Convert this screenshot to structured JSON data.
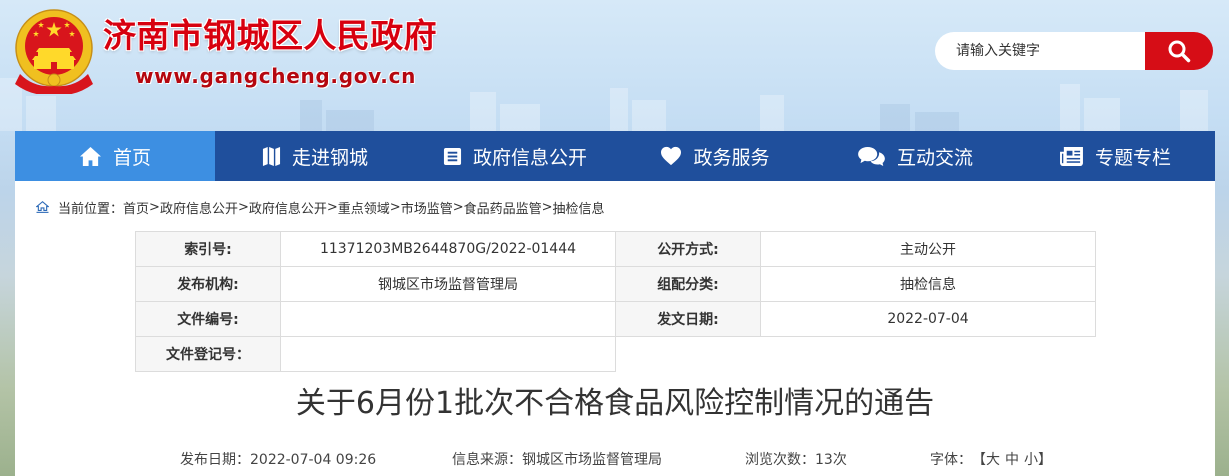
{
  "site": {
    "title": "济南市钢城区人民政府",
    "url": "www.gangcheng.gov.cn",
    "emblem_icon": "national-emblem-icon"
  },
  "search": {
    "placeholder": "请输入关键字",
    "button_icon": "search-icon"
  },
  "nav": {
    "active_index": 0,
    "items": [
      {
        "label": "首页",
        "icon": "home-icon"
      },
      {
        "label": "走进钢城",
        "icon": "map-icon"
      },
      {
        "label": "政府信息公开",
        "icon": "list-icon"
      },
      {
        "label": "政务服务",
        "icon": "heart-icon"
      },
      {
        "label": "互动交流",
        "icon": "chat-icon"
      },
      {
        "label": "专题专栏",
        "icon": "newspaper-icon"
      }
    ]
  },
  "breadcrumb": {
    "icon": "home-icon",
    "prefix": "当前位置：",
    "separator": ">",
    "items": [
      "首页",
      "政府信息公开",
      "政府信息公开",
      "重点领域",
      "市场监管",
      "食品药品监管",
      "抽检信息"
    ]
  },
  "info_table": {
    "rows": [
      [
        {
          "label": "索引号:",
          "value": "11371203MB2644870G/2022-01444"
        },
        {
          "label": "公开方式:",
          "value": "主动公开"
        }
      ],
      [
        {
          "label": "发布机构:",
          "value": "钢城区市场监督管理局"
        },
        {
          "label": "组配分类:",
          "value": "抽检信息"
        }
      ],
      [
        {
          "label": "文件编号:",
          "value": ""
        },
        {
          "label": "发文日期:",
          "value": "2022-07-04"
        }
      ],
      [
        {
          "label": "文件登记号：",
          "value": ""
        }
      ]
    ]
  },
  "article": {
    "title": "关于6月份1批次不合格食品风险控制情况的通告",
    "meta": {
      "publish_date_label": "发布日期：",
      "publish_date": "2022-07-04 09:26",
      "source_label": "信息来源：",
      "source": "钢城区市场监督管理局",
      "views_label": "浏览次数：",
      "views": "13次",
      "font_size_label": "字体：",
      "font_size_open": "【",
      "font_size_options": [
        "大",
        "中",
        "小"
      ],
      "font_size_close": "】"
    }
  },
  "colors": {
    "brand_red": "#d7000f",
    "nav_bg": "#1f4f9c",
    "nav_active": "#3d8fe2",
    "search_button": "#d60d16"
  }
}
